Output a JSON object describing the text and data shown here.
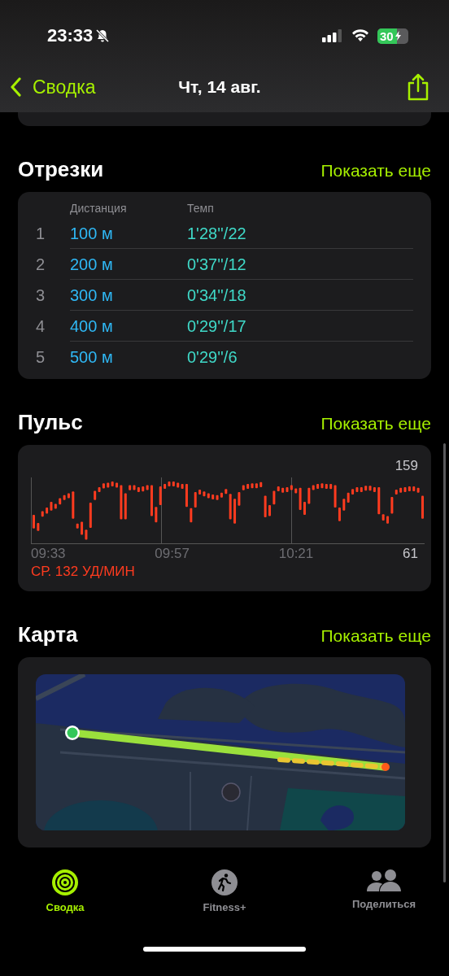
{
  "status_bar": {
    "time": "23:33",
    "battery": "30"
  },
  "nav": {
    "back": "Сводка",
    "title": "Чт, 14 авг."
  },
  "splits": {
    "title": "Отрезки",
    "more": "Показать еще",
    "columns": [
      "Дистанция",
      "Темп"
    ],
    "rows": [
      {
        "index": "1",
        "distance": "100 м",
        "pace": "1'28''/22"
      },
      {
        "index": "2",
        "distance": "200 м",
        "pace": "0'37''/12"
      },
      {
        "index": "3",
        "distance": "300 м",
        "pace": "0'34''/18"
      },
      {
        "index": "4",
        "distance": "400 м",
        "pace": "0'29''/17"
      },
      {
        "index": "5",
        "distance": "500 м",
        "pace": "0'29''/6"
      }
    ]
  },
  "pulse": {
    "title": "Пульс",
    "more": "Показать еще",
    "max": "159",
    "min": "61",
    "times": [
      "09:33",
      "09:57",
      "10:21"
    ],
    "average": "СР. 132 УД/МИН"
  },
  "map": {
    "title": "Карта",
    "more": "Показать еще",
    "kind": "picture"
  },
  "tabs": [
    {
      "label": "Сводка",
      "selected": true,
      "kind": "rings"
    },
    {
      "label": "Fitness+",
      "selected": false,
      "kind": "runner"
    },
    {
      "label": "Поделиться",
      "selected": false,
      "kind": "people"
    }
  ]
}
